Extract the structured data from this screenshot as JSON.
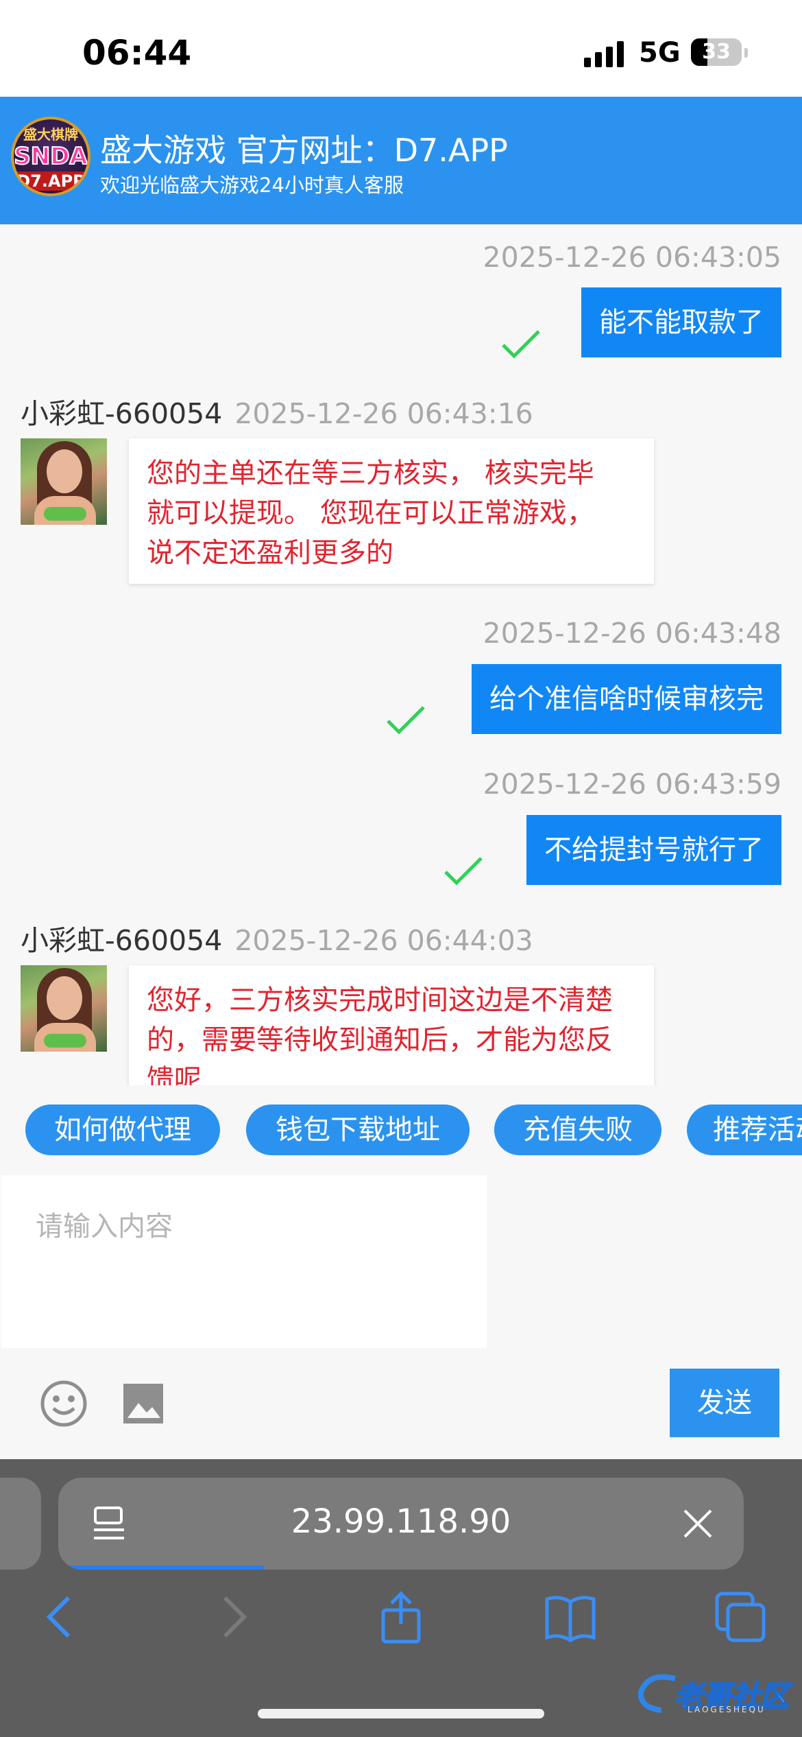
{
  "status_bar": {
    "time": "06:44",
    "network": "5G",
    "battery": "33"
  },
  "header": {
    "logo": {
      "line1": "盛大棋牌",
      "line2": "SNDA",
      "line3": "D7.APP"
    },
    "title": "盛大游戏 官方网址：D7.APP",
    "subtitle": "欢迎光临盛大游戏24小时真人客服"
  },
  "messages": [
    {
      "side": "me",
      "time": "2025-12-26 06:43:05",
      "text": "能不能取款了",
      "status": "read-check"
    },
    {
      "side": "agent",
      "name": "小彩虹-660054",
      "time": "2025-12-26 06:43:16",
      "lines": [
        "您的主单还在等三方核实， 核实完毕",
        "就可以提现。 您现在可以正常游戏，",
        "说不定还盈利更多的"
      ]
    },
    {
      "side": "me",
      "time": "2025-12-26 06:43:48",
      "text": "给个准信啥时候审核完",
      "status": "read-check"
    },
    {
      "side": "me",
      "time": "2025-12-26 06:43:59",
      "text": "不给提封号就行了",
      "status": "read-check"
    },
    {
      "side": "agent",
      "name": "小彩虹-660054",
      "time": "2025-12-26 06:44:03",
      "lines": [
        "您好，三方核实完成时间这边是不清楚",
        "的，需要等待收到通知后，才能为您反",
        "馈呢"
      ]
    }
  ],
  "quick_replies": [
    "如何做代理",
    "钱包下载地址",
    "充值失败",
    "推荐活动"
  ],
  "composer": {
    "placeholder": "请输入内容",
    "send_label": "发送"
  },
  "browser": {
    "url": "23.99.118.90",
    "load_progress": 0.3
  },
  "watermark": {
    "text": "老哥社区",
    "sub": "LAOGESHEQU"
  },
  "colors": {
    "header": "#2b93ef",
    "my_bubble": "#1187f6",
    "agent_text": "#e0242e",
    "check": "#2fd158"
  }
}
